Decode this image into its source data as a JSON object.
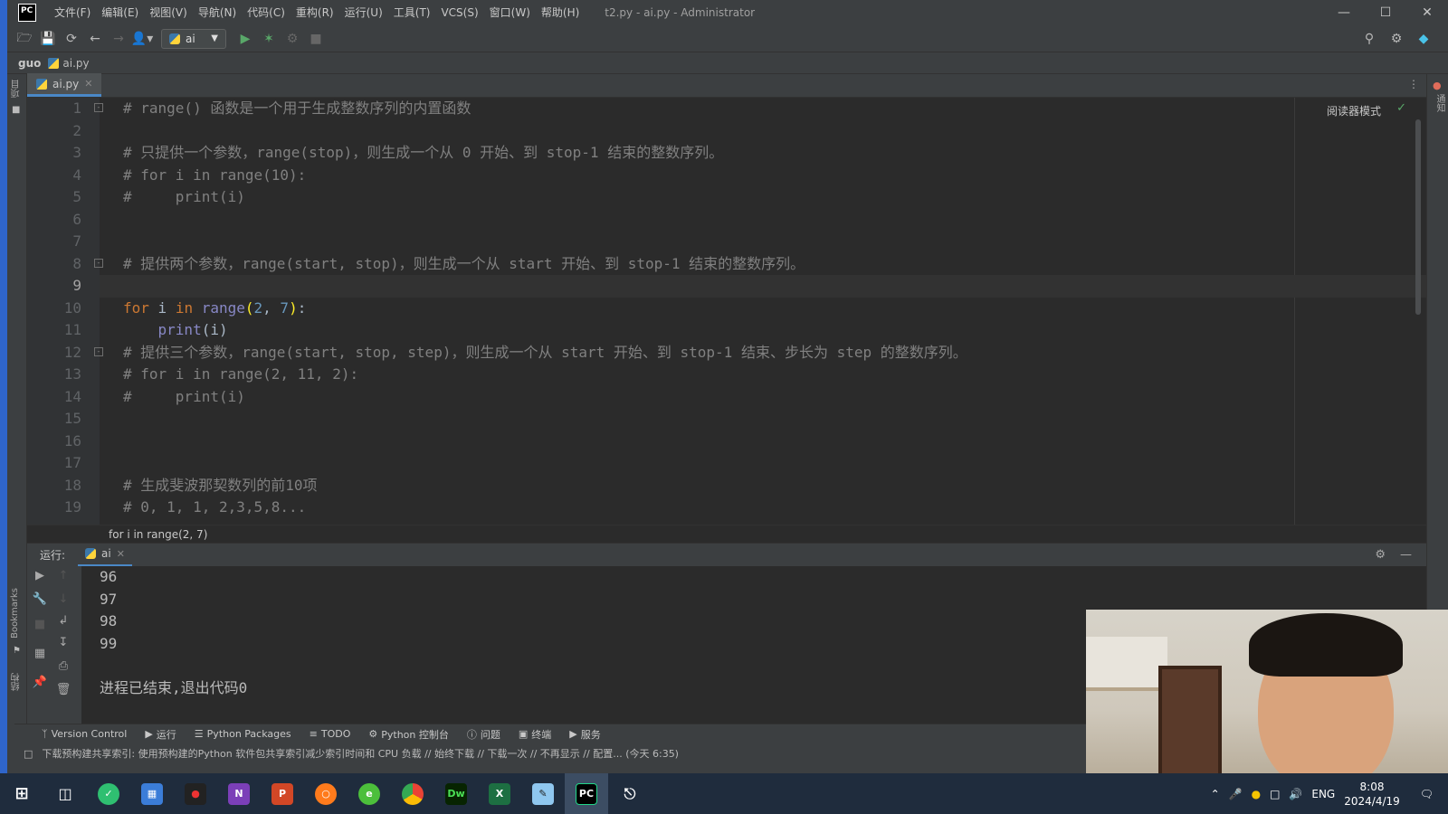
{
  "titlebar": {
    "logo": "PC",
    "menu": [
      "文件(F)",
      "编辑(E)",
      "视图(V)",
      "导航(N)",
      "代码(C)",
      "重构(R)",
      "运行(U)",
      "工具(T)",
      "VCS(S)",
      "窗口(W)",
      "帮助(H)"
    ],
    "window_title": "t2.py - ai.py - Administrator"
  },
  "toolbar": {
    "run_config": "ai"
  },
  "breadcrumb": {
    "root": "guo",
    "file": "ai.py"
  },
  "editor": {
    "tab": "ai.py",
    "reader_mode": "阅读器模式",
    "lines": [
      {
        "n": "1",
        "text": "# range() 函数是一个用于生成整数序列的内置函数"
      },
      {
        "n": "2",
        "text": ""
      },
      {
        "n": "3",
        "text": "# 只提供一个参数，range(stop)，则生成一个从 0 开始、到 stop-1 结束的整数序列。"
      },
      {
        "n": "4",
        "text": "# for i in range(10):"
      },
      {
        "n": "5",
        "text": "#     print(i)"
      },
      {
        "n": "6",
        "text": ""
      },
      {
        "n": "7",
        "text": ""
      },
      {
        "n": "8",
        "text": "# 提供两个参数，range(start, stop)，则生成一个从 start 开始、到 stop-1 结束的整数序列。"
      },
      {
        "n": "9",
        "text": ""
      },
      {
        "n": "10",
        "text": ""
      },
      {
        "n": "11",
        "text": ""
      },
      {
        "n": "12",
        "text": "# 提供三个参数，range(start, stop, step)，则生成一个从 start 开始、到 stop-1 结束、步长为 step 的整数序列。"
      },
      {
        "n": "13",
        "text": "# for i in range(2, 11, 2):"
      },
      {
        "n": "14",
        "text": "#     print(i)"
      },
      {
        "n": "15",
        "text": ""
      },
      {
        "n": "16",
        "text": ""
      },
      {
        "n": "17",
        "text": ""
      },
      {
        "n": "18",
        "text": "# 生成斐波那契数列的前10项"
      },
      {
        "n": "19",
        "text": "# 0, 1, 1, 2,3,5,8..."
      }
    ],
    "line9": {
      "kw_for": "for",
      "var_i": " i ",
      "kw_in": "in",
      "fn_range": " range",
      "lp": "(",
      "arg1": "2",
      "sep": ", ",
      "arg2": "7",
      "rp": ")",
      "colon": ":"
    },
    "line10": {
      "indent": "    ",
      "fn_print": "print",
      "args": "(i)"
    },
    "status_crumb": "for i in range(2, 7)"
  },
  "run": {
    "label": "运行:",
    "tab": "ai",
    "output": [
      "96",
      "97",
      "98",
      "99",
      "",
      "进程已结束,退出代码0"
    ]
  },
  "bottom_tools": [
    "Version Control",
    "运行",
    "Python Packages",
    "TODO",
    "Python 控制台",
    "问题",
    "终端",
    "服务"
  ],
  "side_labels": {
    "project": "项目",
    "bookmarks": "Bookmarks",
    "structure": "结构",
    "notifications": "通知"
  },
  "status_message": "下载预构建共享索引: 使用预构建的Python 软件包共享索引减少索引时间和 CPU 负载 // 始终下载 // 下载一次 // 不再显示 // 配置... (今天 6:35)",
  "taskbar": {
    "tray_lang": "ENG",
    "time": "8:08",
    "date": "2024/4/19"
  }
}
